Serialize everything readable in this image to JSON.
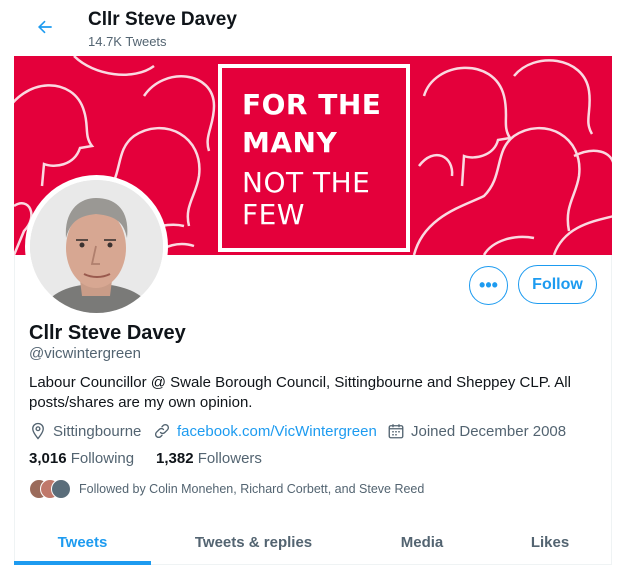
{
  "header": {
    "title": "Cllr Steve Davey",
    "tweet_count": "14.7K Tweets"
  },
  "banner": {
    "slogan": [
      "FOR THE",
      "MANY",
      "NOT THE",
      "FEW"
    ]
  },
  "profile": {
    "name": "Cllr Steve Davey",
    "handle": "@vicwintergreen",
    "bio": "Labour Councillor @ Swale Borough Council, Sittingbourne and Sheppey CLP. All posts/shares are my own opinion.",
    "location": "Sittingbourne",
    "website": "facebook.com/VicWintergreen",
    "joined": "Joined December 2008",
    "following_count": "3,016",
    "following_label": "Following",
    "followers_count": "1,382",
    "followers_label": "Followers",
    "followed_by": "Followed by Colin Monehen, Richard Corbett, and Steve Reed"
  },
  "actions": {
    "more_label": "•••",
    "follow_label": "Follow"
  },
  "tabs": [
    {
      "label": "Tweets",
      "active": true
    },
    {
      "label": "Tweets & replies",
      "active": false
    },
    {
      "label": "Media",
      "active": false
    },
    {
      "label": "Likes",
      "active": false
    }
  ],
  "colors": {
    "accent": "#1d9bf0",
    "banner": "#e4003b",
    "text": "#0f1419",
    "secondary": "#536471"
  }
}
